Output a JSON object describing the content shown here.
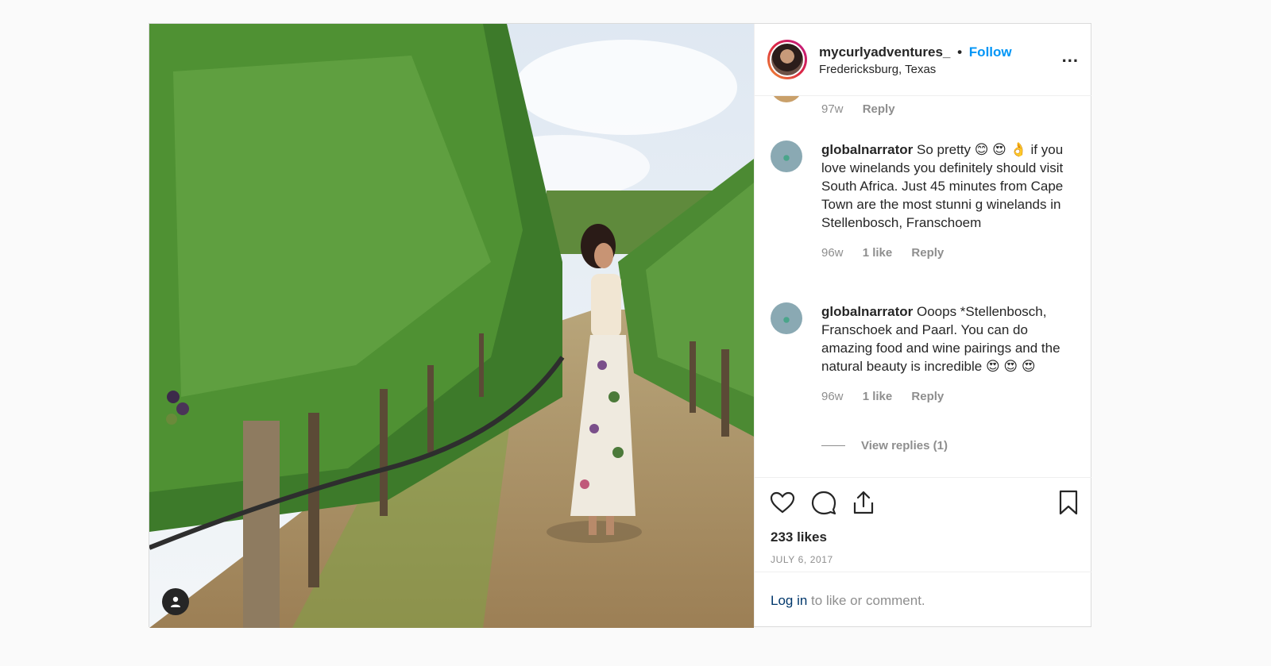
{
  "header": {
    "username": "mycurlyadventures_",
    "separator": "•",
    "follow_label": "Follow",
    "location": "Fredericksburg, Texas",
    "more_label": "..."
  },
  "previous_comment_meta": {
    "time": "97w",
    "reply_label": "Reply"
  },
  "comments": [
    {
      "username": "globalnarrator",
      "text": "So pretty 😊 😍 👌  if you love winelands you definitely should visit South Africa. Just 45 minutes from Cape Town are the most stunni g winelands in Stellenbosch, Franschoem",
      "time": "96w",
      "likes": "1 like",
      "reply_label": "Reply"
    },
    {
      "username": "globalnarrator",
      "text": "Ooops *Stellenbosch, Franschoek and Paarl. You can do amazing food and wine pairings and the natural beauty is incredible 😍 😍 😍",
      "time": "96w",
      "likes": "1 like",
      "reply_label": "Reply"
    }
  ],
  "view_replies_label": "View replies (1)",
  "likes_count": "233 likes",
  "date": "JULY 6, 2017",
  "footer": {
    "login_link": "Log in",
    "login_rest": " to like or comment."
  },
  "icons": {
    "like": "heart-icon",
    "comment": "comment-bubble-icon",
    "share": "share-icon",
    "save": "bookmark-icon",
    "user_tag": "user-icon"
  },
  "colors": {
    "follow": "#0095f6",
    "login_link": "#00376b",
    "muted": "#8e8e8e"
  }
}
